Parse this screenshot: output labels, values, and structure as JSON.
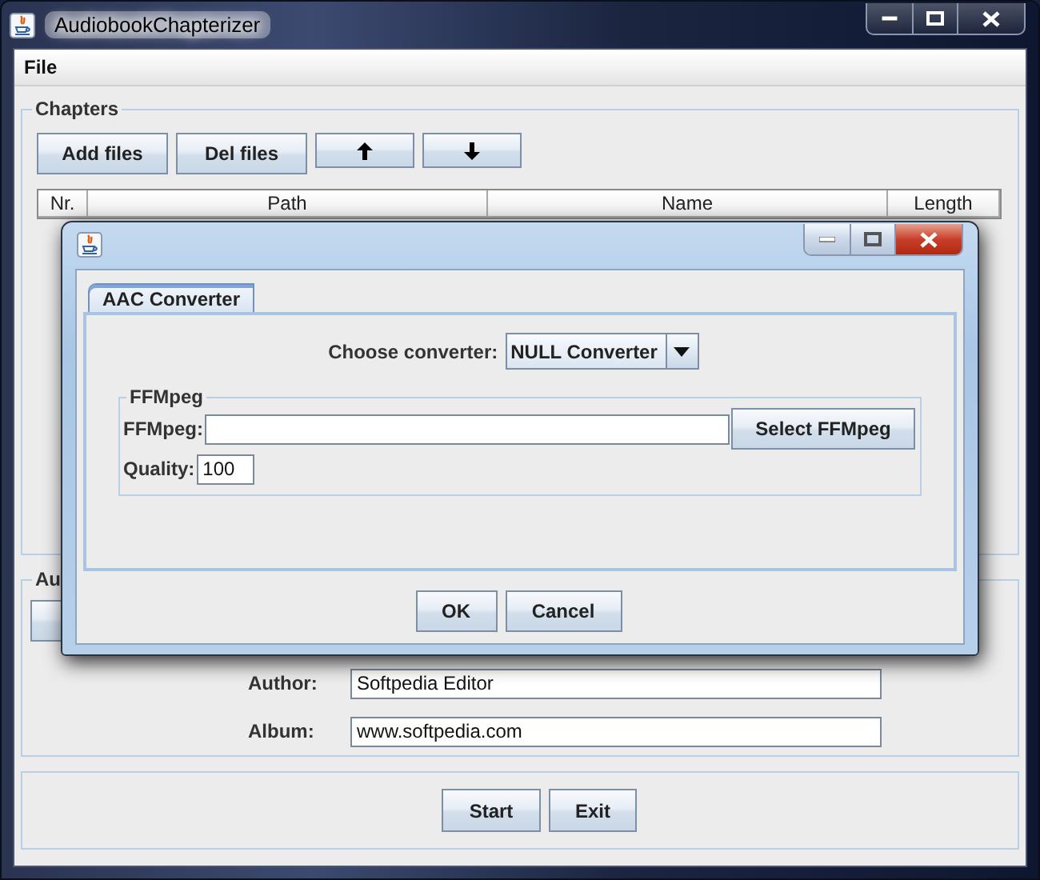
{
  "window": {
    "title": "AudiobookChapterizer"
  },
  "menu": [
    {
      "label": "File"
    }
  ],
  "chapters": {
    "title": "Chapters",
    "buttons": [
      {
        "kind": "text",
        "label": "Add files"
      },
      {
        "kind": "text",
        "label": "Del files"
      },
      {
        "kind": "up"
      },
      {
        "kind": "down"
      }
    ],
    "columns": [
      "Nr.",
      "Path",
      "Name",
      "Length"
    ]
  },
  "audio": {
    "title": "Au",
    "fields": [
      {
        "label": "Author:",
        "value": "Softpedia Editor"
      },
      {
        "label": "Album:",
        "value": "www.softpedia.com"
      }
    ]
  },
  "buttons": [
    "Start",
    "Exit"
  ],
  "dialog": {
    "tabs": [
      {
        "label": "AAC Converter",
        "selected": true
      }
    ],
    "converter": {
      "label": "Choose converter:",
      "value": "NULL Converter"
    },
    "ffmpeg": {
      "title": "FFMpeg",
      "path_label": "FFMpeg:",
      "select_button": "Select FFMpeg",
      "quality_label": "Quality:",
      "quality_value": "100"
    },
    "buttons": [
      "OK",
      "Cancel"
    ]
  }
}
